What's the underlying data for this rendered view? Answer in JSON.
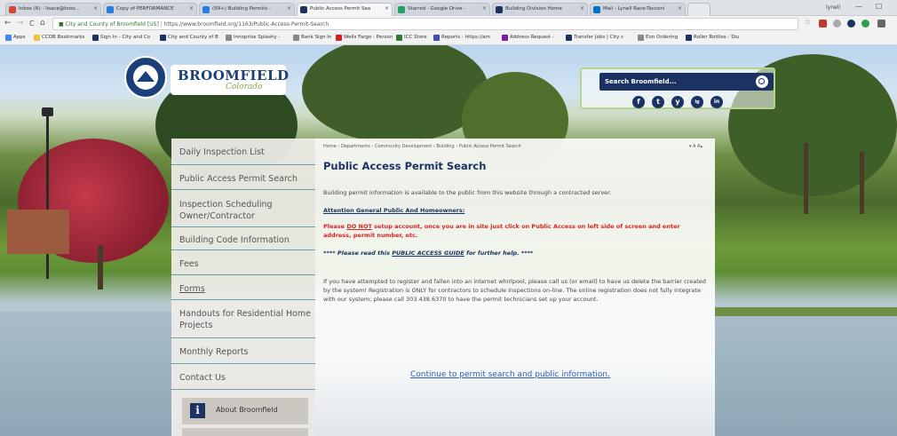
{
  "browser": {
    "tabs": [
      {
        "label": "Inbox (6) - lisace@broo...",
        "active": false,
        "fav": "#d44638"
      },
      {
        "label": "Copy of PERFORMANCE",
        "active": false,
        "fav": "#2a7de1"
      },
      {
        "label": "(99+) Building Permits -",
        "active": false,
        "fav": "#2a7de1"
      },
      {
        "label": "Public Access Permit Sea",
        "active": true,
        "fav": "#1b3263"
      },
      {
        "label": "Starred - Google Drive -",
        "active": false,
        "fav": "#1fa463"
      },
      {
        "label": "Building Division Home",
        "active": false,
        "fav": "#1b3263"
      },
      {
        "label": "Mail - Lynell Race-Tacconi",
        "active": false,
        "fav": "#0072c6"
      }
    ],
    "user_label": "lynell",
    "controls": {
      "minimize": "—",
      "restore": "☐"
    },
    "nav": {
      "back": "←",
      "forward": "→",
      "reload": "C",
      "home": "⌂"
    },
    "url": {
      "site": "City and County of Broomfield [US]",
      "separator": " | ",
      "address": "https://www.broomfield.org/1163/Public-Access-Permit-Search"
    },
    "bookmarks": [
      {
        "label": "Apps",
        "color": "#4285f4"
      },
      {
        "label": "CCOB Bookmarks",
        "color": "#f0c040"
      },
      {
        "label": "Sign In - City and Co",
        "color": "#1b3263"
      },
      {
        "label": "City and County of B",
        "color": "#1b3263"
      },
      {
        "label": "Innoprise Splashy -",
        "color": "#888888"
      },
      {
        "label": "Bank Sign In",
        "color": "#888888"
      },
      {
        "label": "Wells Fargo - Person",
        "color": "#d71e28"
      },
      {
        "label": "ICC Store",
        "color": "#2e7d32"
      },
      {
        "label": "Reports - https://am",
        "color": "#3f51b5"
      },
      {
        "label": "Address Request -",
        "color": "#7b1fa2"
      },
      {
        "label": "Transfer Jobs | City c",
        "color": "#1b3263"
      },
      {
        "label": "Eon Ordering",
        "color": "#888888"
      },
      {
        "label": "Roller Bottles - Stu",
        "color": "#1b3263"
      }
    ]
  },
  "header": {
    "logo_main": "BROOMFIELD",
    "logo_sub": "Colorado",
    "search_placeholder": "Search Broomfield...",
    "social": [
      "f",
      "t",
      "y",
      "ig",
      "in"
    ]
  },
  "sidebar": {
    "items": [
      "Daily Inspection List",
      "Public Access Permit Search",
      "Inspection Scheduling Owner/Contractor",
      "Building Code Information",
      "Fees",
      "Forms",
      "Handouts for Residential Home Projects",
      "Monthly Reports",
      "Contact Us"
    ],
    "about_label": "About Broomfield",
    "about_icon": "i"
  },
  "main": {
    "breadcrumb": "Home › Departments › Community Development › Building › Public Access Permit Search",
    "text_size": "▾ A  A▴",
    "title": "Public Access Permit Search",
    "intro": "Building permit information is available to the public from this website through a contracted server.",
    "attention": "Attention General Public And Homeowners:",
    "warning_pre": "Please ",
    "warning_emph": "DO NOT",
    "warning_post": " setup account, once you are in site just click on Public Access on left side of screen and enter address, permit number, etc.",
    "guide_pre": "**** Please read this ",
    "guide_link": "PUBLIC ACCESS GUIDE",
    "guide_post": " for further help. ****",
    "whirlpool": "If you have attempted to register and fallen into an internet whirlpool, please call us (or email) to have us delete the barrier created by the system! Registration is ONLY for contractors to schedule inspections on-line. The online registration does not fully integrate with our system; please call 303.438.6370 to have the permit technicians set up your account.",
    "continue_link": "Continue to permit search and public information."
  }
}
